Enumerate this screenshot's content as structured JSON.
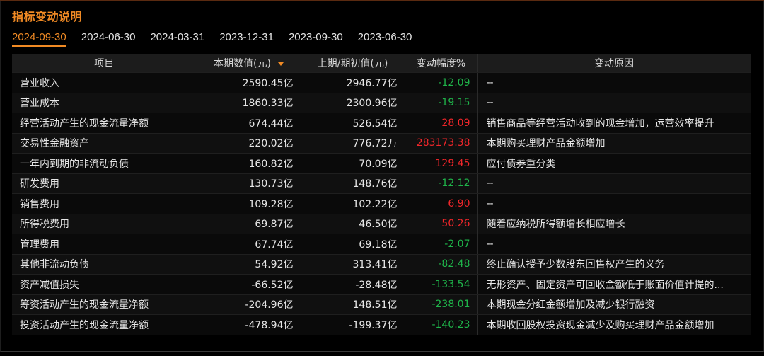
{
  "title": "指标变动说明",
  "tabs": [
    "2024-09-30",
    "2024-06-30",
    "2024-03-31",
    "2023-12-31",
    "2023-09-30",
    "2023-06-30"
  ],
  "active_tab": "2024-09-30",
  "colors": {
    "accent": "#f08a24",
    "up": "#f0262a",
    "down": "#1fb44a",
    "background": "#000000"
  },
  "table": {
    "headers": [
      "项目",
      "本期数值(元)",
      "上期/期初值(元)",
      "变动幅度%",
      "变动原因"
    ],
    "sort_column": "本期数值(元)",
    "sort_icon": "sort-desc-icon",
    "rows": [
      {
        "item": "营业收入",
        "current": "2590.45亿",
        "previous": "2946.77亿",
        "change": "-12.09",
        "reason": "--"
      },
      {
        "item": "营业成本",
        "current": "1860.33亿",
        "previous": "2300.96亿",
        "change": "-19.15",
        "reason": "--"
      },
      {
        "item": "经营活动产生的现金流量净额",
        "current": "674.44亿",
        "previous": "526.54亿",
        "change": "28.09",
        "reason": "销售商品等经营活动收到的现金增加，运营效率提升"
      },
      {
        "item": "交易性金融资产",
        "current": "220.02亿",
        "previous": "776.72万",
        "change": "283173.38",
        "reason": "本期购买理财产品金额增加"
      },
      {
        "item": "一年内到期的非流动负债",
        "current": "160.82亿",
        "previous": "70.09亿",
        "change": "129.45",
        "reason": "应付债券重分类"
      },
      {
        "item": "研发费用",
        "current": "130.73亿",
        "previous": "148.76亿",
        "change": "-12.12",
        "reason": "--"
      },
      {
        "item": "销售费用",
        "current": "109.28亿",
        "previous": "102.22亿",
        "change": "6.90",
        "reason": "--"
      },
      {
        "item": "所得税费用",
        "current": "69.87亿",
        "previous": "46.50亿",
        "change": "50.26",
        "reason": "随着应纳税所得额增长相应增长"
      },
      {
        "item": "管理费用",
        "current": "67.74亿",
        "previous": "69.18亿",
        "change": "-2.07",
        "reason": "--"
      },
      {
        "item": "其他非流动负债",
        "current": "54.92亿",
        "previous": "313.41亿",
        "change": "-82.48",
        "reason": "终止确认授予少数股东回售权产生的义务"
      },
      {
        "item": "资产减值损失",
        "current": "-66.52亿",
        "previous": "-28.48亿",
        "change": "-133.54",
        "reason": "无形资产、固定资产可回收金额低于账面价值计提的..."
      },
      {
        "item": "筹资活动产生的现金流量净额",
        "current": "-204.96亿",
        "previous": "148.51亿",
        "change": "-238.01",
        "reason": "本期现金分红金额增加及减少银行融资"
      },
      {
        "item": "投资活动产生的现金流量净额",
        "current": "-478.94亿",
        "previous": "-199.37亿",
        "change": "-140.23",
        "reason": "本期收回股权投资现金减少及购买理财产品金额增加"
      }
    ]
  }
}
